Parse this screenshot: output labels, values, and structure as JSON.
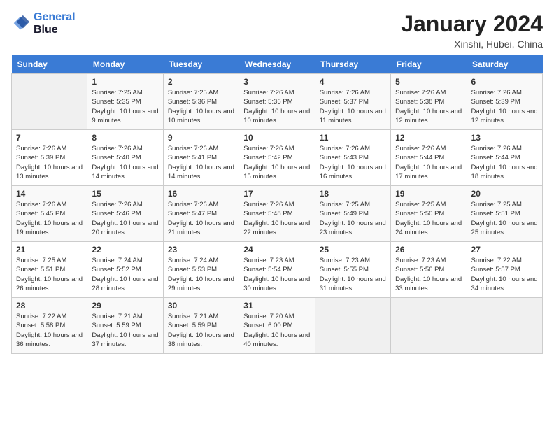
{
  "header": {
    "logo_line1": "General",
    "logo_line2": "Blue",
    "month": "January 2024",
    "location": "Xinshi, Hubei, China"
  },
  "weekdays": [
    "Sunday",
    "Monday",
    "Tuesday",
    "Wednesday",
    "Thursday",
    "Friday",
    "Saturday"
  ],
  "weeks": [
    [
      {
        "day": "",
        "sunrise": "",
        "sunset": "",
        "daylight": ""
      },
      {
        "day": "1",
        "sunrise": "Sunrise: 7:25 AM",
        "sunset": "Sunset: 5:35 PM",
        "daylight": "Daylight: 10 hours and 9 minutes."
      },
      {
        "day": "2",
        "sunrise": "Sunrise: 7:25 AM",
        "sunset": "Sunset: 5:36 PM",
        "daylight": "Daylight: 10 hours and 10 minutes."
      },
      {
        "day": "3",
        "sunrise": "Sunrise: 7:26 AM",
        "sunset": "Sunset: 5:36 PM",
        "daylight": "Daylight: 10 hours and 10 minutes."
      },
      {
        "day": "4",
        "sunrise": "Sunrise: 7:26 AM",
        "sunset": "Sunset: 5:37 PM",
        "daylight": "Daylight: 10 hours and 11 minutes."
      },
      {
        "day": "5",
        "sunrise": "Sunrise: 7:26 AM",
        "sunset": "Sunset: 5:38 PM",
        "daylight": "Daylight: 10 hours and 12 minutes."
      },
      {
        "day": "6",
        "sunrise": "Sunrise: 7:26 AM",
        "sunset": "Sunset: 5:39 PM",
        "daylight": "Daylight: 10 hours and 12 minutes."
      }
    ],
    [
      {
        "day": "7",
        "sunrise": "Sunrise: 7:26 AM",
        "sunset": "Sunset: 5:39 PM",
        "daylight": "Daylight: 10 hours and 13 minutes."
      },
      {
        "day": "8",
        "sunrise": "Sunrise: 7:26 AM",
        "sunset": "Sunset: 5:40 PM",
        "daylight": "Daylight: 10 hours and 14 minutes."
      },
      {
        "day": "9",
        "sunrise": "Sunrise: 7:26 AM",
        "sunset": "Sunset: 5:41 PM",
        "daylight": "Daylight: 10 hours and 14 minutes."
      },
      {
        "day": "10",
        "sunrise": "Sunrise: 7:26 AM",
        "sunset": "Sunset: 5:42 PM",
        "daylight": "Daylight: 10 hours and 15 minutes."
      },
      {
        "day": "11",
        "sunrise": "Sunrise: 7:26 AM",
        "sunset": "Sunset: 5:43 PM",
        "daylight": "Daylight: 10 hours and 16 minutes."
      },
      {
        "day": "12",
        "sunrise": "Sunrise: 7:26 AM",
        "sunset": "Sunset: 5:44 PM",
        "daylight": "Daylight: 10 hours and 17 minutes."
      },
      {
        "day": "13",
        "sunrise": "Sunrise: 7:26 AM",
        "sunset": "Sunset: 5:44 PM",
        "daylight": "Daylight: 10 hours and 18 minutes."
      }
    ],
    [
      {
        "day": "14",
        "sunrise": "Sunrise: 7:26 AM",
        "sunset": "Sunset: 5:45 PM",
        "daylight": "Daylight: 10 hours and 19 minutes."
      },
      {
        "day": "15",
        "sunrise": "Sunrise: 7:26 AM",
        "sunset": "Sunset: 5:46 PM",
        "daylight": "Daylight: 10 hours and 20 minutes."
      },
      {
        "day": "16",
        "sunrise": "Sunrise: 7:26 AM",
        "sunset": "Sunset: 5:47 PM",
        "daylight": "Daylight: 10 hours and 21 minutes."
      },
      {
        "day": "17",
        "sunrise": "Sunrise: 7:26 AM",
        "sunset": "Sunset: 5:48 PM",
        "daylight": "Daylight: 10 hours and 22 minutes."
      },
      {
        "day": "18",
        "sunrise": "Sunrise: 7:25 AM",
        "sunset": "Sunset: 5:49 PM",
        "daylight": "Daylight: 10 hours and 23 minutes."
      },
      {
        "day": "19",
        "sunrise": "Sunrise: 7:25 AM",
        "sunset": "Sunset: 5:50 PM",
        "daylight": "Daylight: 10 hours and 24 minutes."
      },
      {
        "day": "20",
        "sunrise": "Sunrise: 7:25 AM",
        "sunset": "Sunset: 5:51 PM",
        "daylight": "Daylight: 10 hours and 25 minutes."
      }
    ],
    [
      {
        "day": "21",
        "sunrise": "Sunrise: 7:25 AM",
        "sunset": "Sunset: 5:51 PM",
        "daylight": "Daylight: 10 hours and 26 minutes."
      },
      {
        "day": "22",
        "sunrise": "Sunrise: 7:24 AM",
        "sunset": "Sunset: 5:52 PM",
        "daylight": "Daylight: 10 hours and 28 minutes."
      },
      {
        "day": "23",
        "sunrise": "Sunrise: 7:24 AM",
        "sunset": "Sunset: 5:53 PM",
        "daylight": "Daylight: 10 hours and 29 minutes."
      },
      {
        "day": "24",
        "sunrise": "Sunrise: 7:23 AM",
        "sunset": "Sunset: 5:54 PM",
        "daylight": "Daylight: 10 hours and 30 minutes."
      },
      {
        "day": "25",
        "sunrise": "Sunrise: 7:23 AM",
        "sunset": "Sunset: 5:55 PM",
        "daylight": "Daylight: 10 hours and 31 minutes."
      },
      {
        "day": "26",
        "sunrise": "Sunrise: 7:23 AM",
        "sunset": "Sunset: 5:56 PM",
        "daylight": "Daylight: 10 hours and 33 minutes."
      },
      {
        "day": "27",
        "sunrise": "Sunrise: 7:22 AM",
        "sunset": "Sunset: 5:57 PM",
        "daylight": "Daylight: 10 hours and 34 minutes."
      }
    ],
    [
      {
        "day": "28",
        "sunrise": "Sunrise: 7:22 AM",
        "sunset": "Sunset: 5:58 PM",
        "daylight": "Daylight: 10 hours and 36 minutes."
      },
      {
        "day": "29",
        "sunrise": "Sunrise: 7:21 AM",
        "sunset": "Sunset: 5:59 PM",
        "daylight": "Daylight: 10 hours and 37 minutes."
      },
      {
        "day": "30",
        "sunrise": "Sunrise: 7:21 AM",
        "sunset": "Sunset: 5:59 PM",
        "daylight": "Daylight: 10 hours and 38 minutes."
      },
      {
        "day": "31",
        "sunrise": "Sunrise: 7:20 AM",
        "sunset": "Sunset: 6:00 PM",
        "daylight": "Daylight: 10 hours and 40 minutes."
      },
      {
        "day": "",
        "sunrise": "",
        "sunset": "",
        "daylight": ""
      },
      {
        "day": "",
        "sunrise": "",
        "sunset": "",
        "daylight": ""
      },
      {
        "day": "",
        "sunrise": "",
        "sunset": "",
        "daylight": ""
      }
    ]
  ]
}
